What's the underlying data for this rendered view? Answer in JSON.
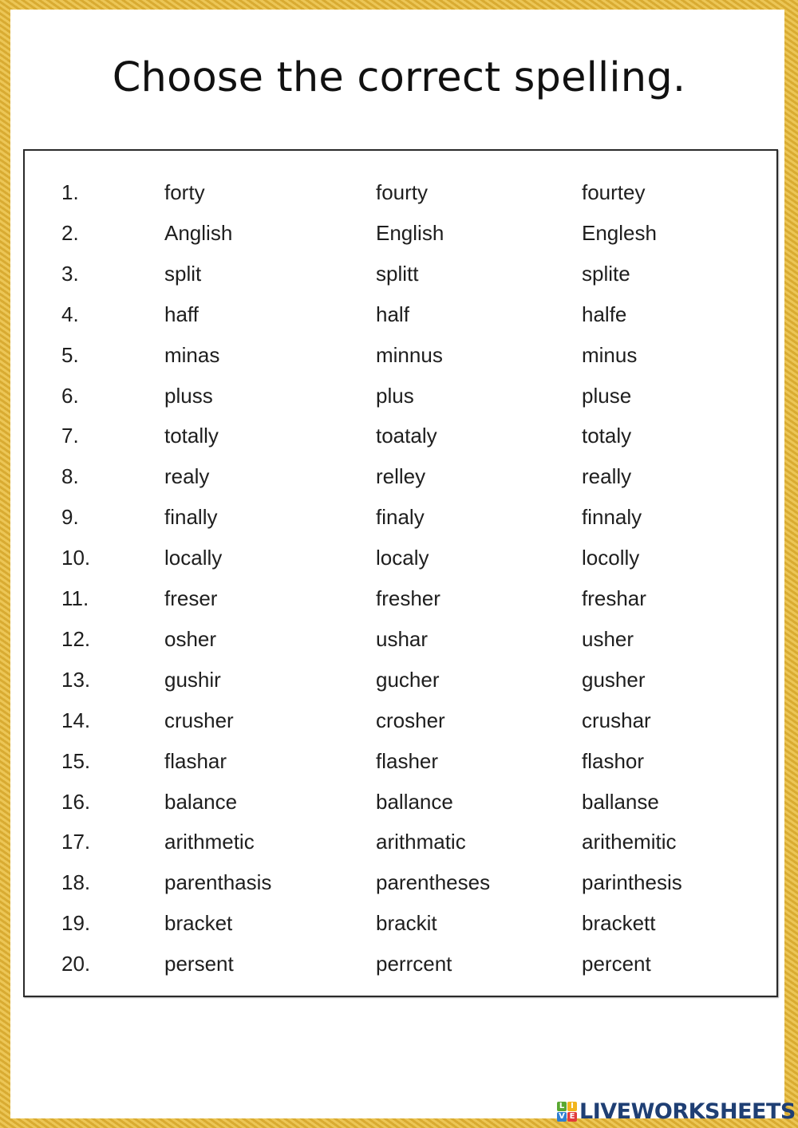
{
  "page": {
    "title": "Choose the correct spelling."
  },
  "colors": {
    "frame_gold": "#e2b63a",
    "text": "#1e1e1e",
    "logo_text": "#1f3f74"
  },
  "items": [
    {
      "number": "1.",
      "options": [
        "forty",
        "fourty",
        "fourtey"
      ]
    },
    {
      "number": "2.",
      "options": [
        "Anglish",
        "English",
        "Englesh"
      ]
    },
    {
      "number": "3.",
      "options": [
        "split",
        "splitt",
        "splite"
      ]
    },
    {
      "number": "4.",
      "options": [
        "haff",
        "half",
        "halfe"
      ]
    },
    {
      "number": "5.",
      "options": [
        "minas",
        "minnus",
        "minus"
      ]
    },
    {
      "number": "6.",
      "options": [
        "pluss",
        "plus",
        "pluse"
      ]
    },
    {
      "number": "7.",
      "options": [
        "totally",
        "toataly",
        "totaly"
      ]
    },
    {
      "number": "8.",
      "options": [
        "realy",
        "relley",
        "really"
      ]
    },
    {
      "number": "9.",
      "options": [
        "finally",
        "finaly",
        "finnaly"
      ]
    },
    {
      "number": "10.",
      "options": [
        "locally",
        "localy",
        "locolly"
      ]
    },
    {
      "number": "11.",
      "options": [
        "freser",
        "fresher",
        "freshar"
      ]
    },
    {
      "number": "12.",
      "options": [
        "osher",
        "ushar",
        "usher"
      ]
    },
    {
      "number": "13.",
      "options": [
        "gushir",
        "gucher",
        "gusher"
      ]
    },
    {
      "number": "14.",
      "options": [
        "crusher",
        "crosher",
        "crushar"
      ]
    },
    {
      "number": "15.",
      "options": [
        "flashar",
        "flasher",
        "flashor"
      ]
    },
    {
      "number": "16.",
      "options": [
        "balance",
        "ballance",
        "ballanse"
      ]
    },
    {
      "number": "17.",
      "options": [
        "arithmetic",
        "arithmatic",
        "arithemitic"
      ]
    },
    {
      "number": "18.",
      "options": [
        "parenthasis",
        "parentheses",
        "parinthesis"
      ]
    },
    {
      "number": "19.",
      "options": [
        "bracket",
        "brackit",
        "brackett"
      ]
    },
    {
      "number": "20.",
      "options": [
        "persent",
        "perrcent",
        "percent"
      ]
    }
  ],
  "logo": {
    "icon_letters": [
      "L",
      "I",
      "V",
      "E"
    ],
    "icon_colors": [
      "#5aa832",
      "#f2b51c",
      "#2f7fd1",
      "#e23b3b"
    ],
    "text": "LIVEWORKSHEETS"
  }
}
